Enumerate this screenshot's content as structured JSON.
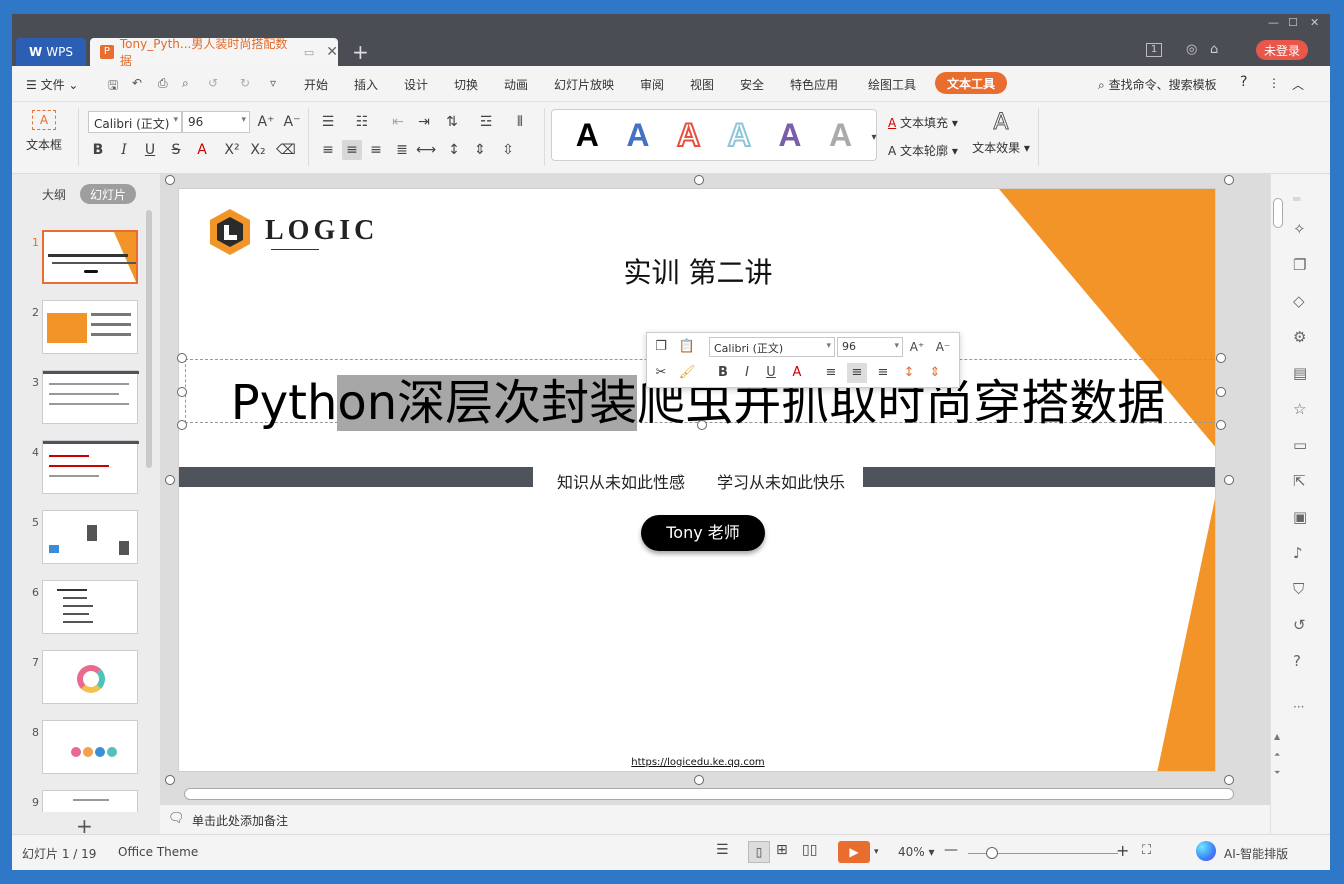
{
  "app": {
    "tab_label": "WPS",
    "doc_tab_title": "Tony_Pyth...男人装时尚搭配数据",
    "login_label": "未登录",
    "badge_count": "1"
  },
  "menu": {
    "items": [
      "文件",
      "开始",
      "插入",
      "设计",
      "切换",
      "动画",
      "幻灯片放映",
      "审阅",
      "视图",
      "安全",
      "特色应用",
      "绘图工具",
      "文本工具"
    ],
    "search_label": "查找命令、搜索模板",
    "help_label": "?",
    "more_label": "⋮"
  },
  "ribbon": {
    "textbox_label": "文本框",
    "font_name": "Calibri (正文)",
    "font_size": "96",
    "fill_label": "文本填充",
    "outline_label": "文本轮廓",
    "effect_label": "文本效果",
    "gallery_letters": [
      "A",
      "A",
      "A",
      "A",
      "A",
      "A"
    ],
    "gallery_colors": [
      "#000000",
      "#4472c4",
      "#e94e3f",
      "#8fc5d8",
      "#7a5fa8",
      "#999999"
    ]
  },
  "left_panel": {
    "tabs": [
      "大纲",
      "幻灯片"
    ],
    "slide_numbers": [
      "1",
      "2",
      "3",
      "4",
      "5",
      "6",
      "7",
      "8",
      "9"
    ],
    "add_label": "+"
  },
  "slide": {
    "logo_text": "LOGIC",
    "subtitle_top": "实训 第二讲",
    "title_selected": "on深层次封装",
    "title_before": "Pyth",
    "title_after": "爬虫并抓取时尚穿搭数据",
    "tagline_1": "知识从未如此性感",
    "tagline_2": "学习从未如此快乐",
    "teacher_button": "Tony 老师",
    "url": "https://logicedu.ke.qq.com",
    "orange": "#f39428",
    "dark_bar": "#4f535b"
  },
  "float_toolbar": {
    "font_name": "Calibri (正文)",
    "font_size": "96"
  },
  "notes": {
    "placeholder": "单击此处添加备注"
  },
  "status": {
    "slide_counter": "幻灯片 1 / 19",
    "theme": "Office Theme",
    "zoom": "40%",
    "ai_label": "AI-智能排版"
  }
}
